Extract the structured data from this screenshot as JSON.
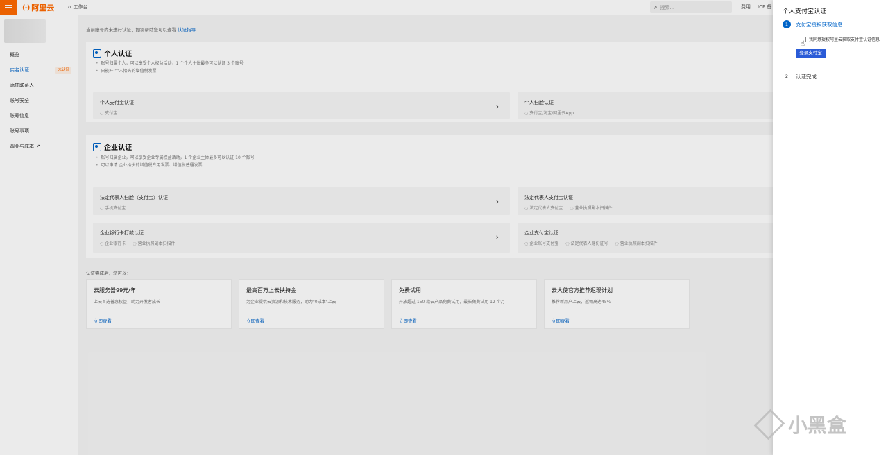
{
  "topbar": {
    "logo_text": "阿里云",
    "logo_mark": "(-)",
    "workbench_label": "工作台",
    "search_placeholder": "搜索...",
    "links": [
      "费用",
      "ICP 备"
    ]
  },
  "sidebar": {
    "items": [
      {
        "label": "概览",
        "active": false
      },
      {
        "label": "实名认证",
        "active": true,
        "badge": "未认证"
      },
      {
        "label": "添加联系人",
        "active": false
      },
      {
        "label": "账号安全",
        "active": false
      },
      {
        "label": "账号信息",
        "active": false
      },
      {
        "label": "账号事项",
        "active": false
      },
      {
        "label": "四业与成本",
        "active": false,
        "external": true
      }
    ]
  },
  "main": {
    "notice_text": "当前账号尚未进行认证，如需帮助您可以查看",
    "notice_link": "认证指导",
    "personal": {
      "title": "个人认证",
      "bullets": [
        "账号归属个人，可以享受个人权益活动，1 个个人主体最多可以认证 3 个账号",
        "只能开 个人抬头的增值税发票"
      ],
      "options": [
        {
          "title": "个人支付宝认证",
          "subs": [
            "支付宝"
          ]
        },
        {
          "title": "个人扫脸认证",
          "subs": [
            "支付宝/淘宝/阿里云App"
          ]
        }
      ]
    },
    "enterprise": {
      "title": "企业认证",
      "bullets": [
        "账号归属企业，可以享受企业专属权益活动，1 个企业主体最多可以认证 10 个账号",
        "可以申请 企业抬头的增值税专用发票、增值税普通发票"
      ],
      "options": [
        {
          "title": "法定代表人扫脸（支付宝）认证",
          "subs": [
            "手机支付宝"
          ]
        },
        {
          "title": "法定代表人支付宝认证",
          "subs": [
            "法定代表人支付宝",
            "营业执照副本扫描件"
          ]
        },
        {
          "title": "企业银行卡打款认证",
          "subs": [
            "企业银行卡",
            "营业执照副本扫描件"
          ]
        },
        {
          "title": "企业支付宝认证",
          "subs": [
            "企业账号支付宝",
            "法定代表人身份证号",
            "营业执照副本扫描件"
          ]
        }
      ]
    },
    "after_title": "认证完成后，您可以：",
    "promos": [
      {
        "title": "云服务器99元/年",
        "desc": "上云首选普惠权益，助力开发者成长",
        "link": "立即查看"
      },
      {
        "title": "最高百万上云扶持金",
        "desc": "为企业提供云资源和技术服务，助力\"0成本\"上云",
        "link": "立即查看"
      },
      {
        "title": "免费试用",
        "desc": "开放超过 150 款云产品免费试用，最长免费试用 12 个月",
        "link": "立即查看"
      },
      {
        "title": "云大使官方推荐返现计划",
        "desc": "推荐新用户上云，返佣高达45%",
        "link": "立即查看"
      }
    ]
  },
  "drawer": {
    "title": "个人支付宝认证",
    "steps": [
      {
        "num": "1",
        "label": "支付宝授权获取信息"
      },
      {
        "num": "2",
        "label": "认证完成"
      }
    ],
    "agree_text": "我同意授权阿里云获取支付宝认证信息",
    "login_button": "登录支付宝"
  },
  "watermark": {
    "text": "小黑盒"
  },
  "colors": {
    "brand": "#ff6a00",
    "link": "#0064c8",
    "button": "#2a5bd7"
  }
}
